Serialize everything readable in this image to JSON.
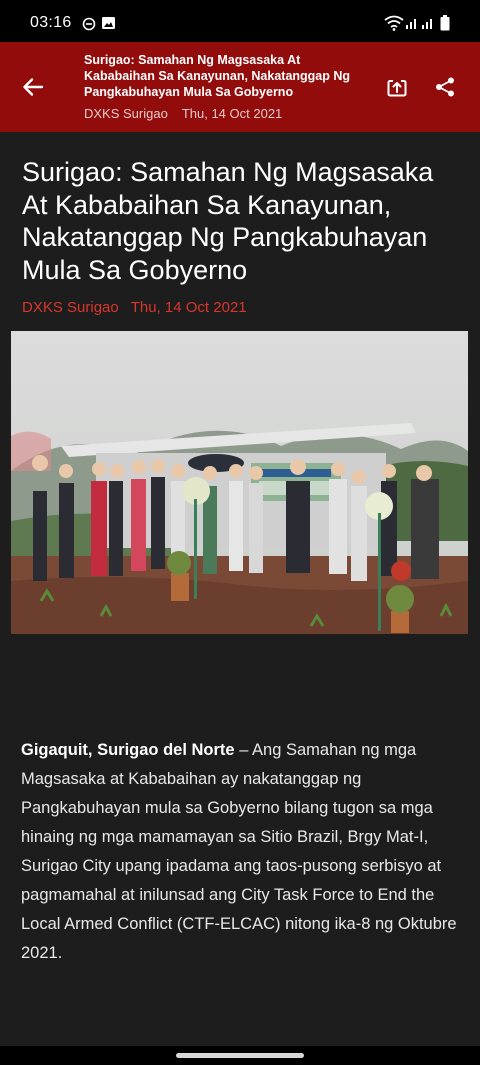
{
  "status_bar": {
    "time": "03:16",
    "icons": [
      "dnd-icon",
      "image-icon",
      "wifi-icon",
      "signal-icon",
      "signal-icon",
      "battery-icon"
    ]
  },
  "app_bar": {
    "title": "Surigao: Samahan Ng Magsasaka At Kababaihan Sa Kanayunan, Nakatanggap Ng Pangkabuhayan Mula Sa Gobyerno",
    "source": "DXKS Surigao",
    "date": "Thu, 14 Oct 2021",
    "icons": [
      "back-arrow-icon",
      "open-in-browser-icon",
      "share-icon"
    ],
    "color": "#930c0c"
  },
  "article": {
    "headline": "Surigao: Samahan Ng Magsasaka At Kababaihan Sa Kanayunan, Nakatanggap Ng Pangkabuhayan Mula Sa Gobyerno",
    "source": "DXKS Surigao",
    "date": "Thu, 14 Oct 2021",
    "source_color": "#d9362c",
    "dateline": "Gigaquit, Surigao del Norte",
    "body": " – Ang Samahan ng mga Magsasaka at Kababaihan ay nakatanggap ng Pangkabuhayan mula sa Gobyerno bilang tugon sa mga hinaing ng mga mamamayan sa Sitio Brazil, Brgy Mat-I, Surigao City upang ipadama ang taos-pusong serbisyo at pagmamahal at inilunsad ang City Task Force to End the Local Armed Conflict (CTF-ELCAC) nitong ika-8 ng Oktubre 2021."
  }
}
